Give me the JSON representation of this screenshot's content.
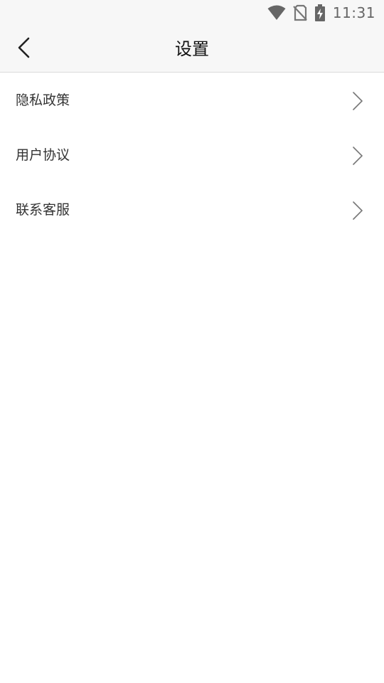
{
  "status_bar": {
    "time": "11:31",
    "icons": [
      "wifi-icon",
      "no-sim-icon",
      "battery-charging-icon"
    ]
  },
  "header": {
    "title": "设置",
    "back_icon": "chevron-left-icon"
  },
  "menu": {
    "items": [
      {
        "label": "隐私政策",
        "icon": "chevron-right-icon"
      },
      {
        "label": "用户协议",
        "icon": "chevron-right-icon"
      },
      {
        "label": "联系客服",
        "icon": "chevron-right-icon"
      }
    ]
  },
  "colors": {
    "header_bg": "#f7f7f7",
    "page_bg": "#ffffff",
    "title_text": "#111111",
    "item_text": "#333333",
    "chevron": "#777777",
    "status_icons": "#666666"
  }
}
